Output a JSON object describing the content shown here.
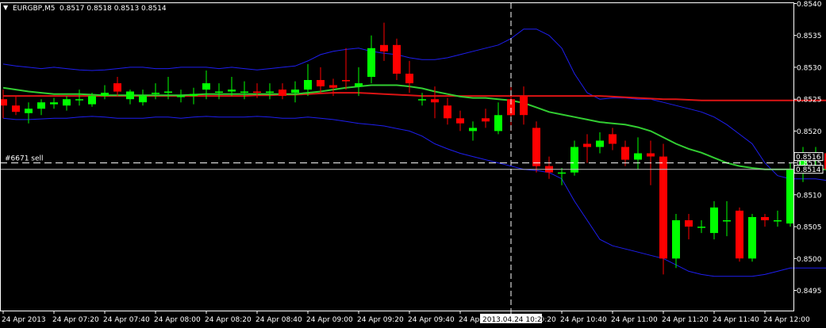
{
  "header": {
    "menu_glyph": "▼",
    "symbol": "EURGBP,M5",
    "ohlc": "0.8517 0.8518 0.8513 0.8514"
  },
  "order_label": "#6671 sell",
  "crosshair_time_label": "2013.04.24 10:20",
  "price_tags": {
    "ask": "0.8516",
    "bid": "0.8514"
  },
  "colors": {
    "background": "#000000",
    "axis": "#ffffff",
    "bull": "#00ff00",
    "bear": "#ff0000",
    "bollinger": "#1e1ef0",
    "ma_fast": "#32cd32",
    "ma_slow": "#dc1414",
    "bid_line": "#c0c0c0"
  },
  "chart_data": {
    "type": "candlestick",
    "symbol": "EURGBP",
    "timeframe": "M5",
    "ylim": [
      0.8492,
      0.854
    ],
    "y_ticks": [
      "0.8540",
      "0.8535",
      "0.8530",
      "0.8525",
      "0.8520",
      "0.8515",
      "0.8510",
      "0.8505",
      "0.8500",
      "0.8495"
    ],
    "x_ticks": [
      "24 Apr 2013",
      "24 Apr 07:20",
      "24 Apr 07:40",
      "24 Apr 08:00",
      "24 Apr 08:20",
      "24 Apr 08:40",
      "24 Apr 09:00",
      "24 Apr 09:20",
      "24 Apr 09:40",
      "24 Apr 10:00",
      "24 Apr 10:20",
      "24 Apr 10:40",
      "24 Apr 11:00",
      "24 Apr 11:20",
      "24 Apr 11:40",
      "24 Apr 12:00"
    ],
    "x_tick_index": [
      0,
      4,
      8,
      12,
      16,
      20,
      24,
      28,
      32,
      36,
      40,
      44,
      48,
      52,
      56,
      60
    ],
    "bid": 0.8514,
    "ask": 0.8516,
    "sell_order": {
      "label": "#6671 sell",
      "price": 0.8515
    },
    "crosshair_index": 40,
    "candles": [
      {
        "o": 0.8525,
        "h": 0.85265,
        "l": 0.8522,
        "c": 0.8524
      },
      {
        "o": 0.8524,
        "h": 0.85255,
        "l": 0.85225,
        "c": 0.8523
      },
      {
        "o": 0.85228,
        "h": 0.85245,
        "l": 0.85212,
        "c": 0.85235
      },
      {
        "o": 0.85235,
        "h": 0.8525,
        "l": 0.85225,
        "c": 0.85245
      },
      {
        "o": 0.85242,
        "h": 0.85252,
        "l": 0.85235,
        "c": 0.85245
      },
      {
        "o": 0.8524,
        "h": 0.85255,
        "l": 0.85232,
        "c": 0.8525
      },
      {
        "o": 0.8525,
        "h": 0.85265,
        "l": 0.8524,
        "c": 0.8525
      },
      {
        "o": 0.85242,
        "h": 0.8526,
        "l": 0.85238,
        "c": 0.85255
      },
      {
        "o": 0.85255,
        "h": 0.85272,
        "l": 0.8525,
        "c": 0.8526
      },
      {
        "o": 0.85275,
        "h": 0.85285,
        "l": 0.85255,
        "c": 0.85262
      },
      {
        "o": 0.8525,
        "h": 0.85265,
        "l": 0.85242,
        "c": 0.85262
      },
      {
        "o": 0.85245,
        "h": 0.85265,
        "l": 0.8524,
        "c": 0.85255
      },
      {
        "o": 0.85258,
        "h": 0.85275,
        "l": 0.8525,
        "c": 0.8526
      },
      {
        "o": 0.8526,
        "h": 0.85285,
        "l": 0.8525,
        "c": 0.85262
      },
      {
        "o": 0.85255,
        "h": 0.85265,
        "l": 0.85245,
        "c": 0.85255
      },
      {
        "o": 0.85255,
        "h": 0.85268,
        "l": 0.85242,
        "c": 0.85258
      },
      {
        "o": 0.85265,
        "h": 0.85295,
        "l": 0.8525,
        "c": 0.85275
      },
      {
        "o": 0.85262,
        "h": 0.85275,
        "l": 0.8525,
        "c": 0.85262
      },
      {
        "o": 0.85262,
        "h": 0.85285,
        "l": 0.85255,
        "c": 0.85265
      },
      {
        "o": 0.85262,
        "h": 0.85278,
        "l": 0.8525,
        "c": 0.85262
      },
      {
        "o": 0.85262,
        "h": 0.85275,
        "l": 0.85252,
        "c": 0.8526
      },
      {
        "o": 0.8526,
        "h": 0.85275,
        "l": 0.8525,
        "c": 0.85262
      },
      {
        "o": 0.85265,
        "h": 0.85275,
        "l": 0.8525,
        "c": 0.85255
      },
      {
        "o": 0.8526,
        "h": 0.85278,
        "l": 0.85245,
        "c": 0.85265
      },
      {
        "o": 0.85265,
        "h": 0.85305,
        "l": 0.85255,
        "c": 0.8528
      },
      {
        "o": 0.8528,
        "h": 0.853,
        "l": 0.8526,
        "c": 0.8527
      },
      {
        "o": 0.85272,
        "h": 0.85282,
        "l": 0.85255,
        "c": 0.85268
      },
      {
        "o": 0.8528,
        "h": 0.8533,
        "l": 0.85265,
        "c": 0.85278
      },
      {
        "o": 0.8527,
        "h": 0.853,
        "l": 0.85255,
        "c": 0.85275
      },
      {
        "o": 0.85285,
        "h": 0.8535,
        "l": 0.85275,
        "c": 0.8533
      },
      {
        "o": 0.85335,
        "h": 0.8537,
        "l": 0.8531,
        "c": 0.85325
      },
      {
        "o": 0.85335,
        "h": 0.85345,
        "l": 0.8528,
        "c": 0.8529
      },
      {
        "o": 0.8529,
        "h": 0.8531,
        "l": 0.8526,
        "c": 0.85275
      },
      {
        "o": 0.8525,
        "h": 0.8526,
        "l": 0.8524,
        "c": 0.8525
      },
      {
        "o": 0.8525,
        "h": 0.8527,
        "l": 0.8522,
        "c": 0.85245
      },
      {
        "o": 0.8524,
        "h": 0.85252,
        "l": 0.8521,
        "c": 0.8522
      },
      {
        "o": 0.8522,
        "h": 0.85232,
        "l": 0.852,
        "c": 0.85212
      },
      {
        "o": 0.852,
        "h": 0.85215,
        "l": 0.85185,
        "c": 0.85205
      },
      {
        "o": 0.8522,
        "h": 0.85235,
        "l": 0.85205,
        "c": 0.85215
      },
      {
        "o": 0.852,
        "h": 0.85245,
        "l": 0.85195,
        "c": 0.85225
      },
      {
        "o": 0.8525,
        "h": 0.8527,
        "l": 0.852,
        "c": 0.85225
      },
      {
        "o": 0.85255,
        "h": 0.8527,
        "l": 0.8521,
        "c": 0.85225
      },
      {
        "o": 0.85205,
        "h": 0.85215,
        "l": 0.85135,
        "c": 0.85145
      },
      {
        "o": 0.85145,
        "h": 0.8516,
        "l": 0.85125,
        "c": 0.85135
      },
      {
        "o": 0.85135,
        "h": 0.85142,
        "l": 0.85115,
        "c": 0.85135
      },
      {
        "o": 0.85135,
        "h": 0.85185,
        "l": 0.8513,
        "c": 0.85175
      },
      {
        "o": 0.8518,
        "h": 0.85195,
        "l": 0.8515,
        "c": 0.85175
      },
      {
        "o": 0.85175,
        "h": 0.85198,
        "l": 0.85165,
        "c": 0.85185
      },
      {
        "o": 0.85195,
        "h": 0.85205,
        "l": 0.8517,
        "c": 0.8518
      },
      {
        "o": 0.85175,
        "h": 0.85185,
        "l": 0.85145,
        "c": 0.85155
      },
      {
        "o": 0.85155,
        "h": 0.8519,
        "l": 0.8514,
        "c": 0.85165
      },
      {
        "o": 0.85165,
        "h": 0.85185,
        "l": 0.85115,
        "c": 0.8516
      },
      {
        "o": 0.8516,
        "h": 0.8518,
        "l": 0.84975,
        "c": 0.85
      },
      {
        "o": 0.85,
        "h": 0.8507,
        "l": 0.84985,
        "c": 0.8506
      },
      {
        "o": 0.8506,
        "h": 0.8507,
        "l": 0.8503,
        "c": 0.8505
      },
      {
        "o": 0.8505,
        "h": 0.8506,
        "l": 0.8504,
        "c": 0.8505
      },
      {
        "o": 0.8504,
        "h": 0.8509,
        "l": 0.8503,
        "c": 0.8508
      },
      {
        "o": 0.8506,
        "h": 0.8509,
        "l": 0.85035,
        "c": 0.8506
      },
      {
        "o": 0.85075,
        "h": 0.8508,
        "l": 0.84995,
        "c": 0.85
      },
      {
        "o": 0.85,
        "h": 0.8507,
        "l": 0.84995,
        "c": 0.85065
      },
      {
        "o": 0.85065,
        "h": 0.8507,
        "l": 0.8505,
        "c": 0.8506
      },
      {
        "o": 0.8506,
        "h": 0.85075,
        "l": 0.8505,
        "c": 0.8506
      },
      {
        "o": 0.85055,
        "h": 0.8515,
        "l": 0.8505,
        "c": 0.8514
      },
      {
        "o": 0.85145,
        "h": 0.85175,
        "l": 0.8512,
        "c": 0.85162
      },
      {
        "o": 0.8516,
        "h": 0.85175,
        "l": 0.85135,
        "c": 0.8516
      },
      {
        "o": 0.85165,
        "h": 0.85175,
        "l": 0.85125,
        "c": 0.8514
      }
    ],
    "bollinger_upper": [
      0.85305,
      0.85302,
      0.853,
      0.85298,
      0.853,
      0.85298,
      0.85296,
      0.85295,
      0.85296,
      0.85298,
      0.853,
      0.853,
      0.85298,
      0.85298,
      0.853,
      0.853,
      0.853,
      0.85298,
      0.853,
      0.85298,
      0.85296,
      0.85298,
      0.853,
      0.85302,
      0.8531,
      0.8532,
      0.85325,
      0.85328,
      0.8533,
      0.85325,
      0.85322,
      0.8532,
      0.85315,
      0.85312,
      0.85312,
      0.85315,
      0.8532,
      0.85325,
      0.8533,
      0.85335,
      0.85345,
      0.8536,
      0.8536,
      0.8535,
      0.8533,
      0.8529,
      0.8526,
      0.8525,
      0.85252,
      0.85252,
      0.8525,
      0.8525,
      0.85245,
      0.8524,
      0.85235,
      0.8523,
      0.85222,
      0.8521,
      0.85195,
      0.8518,
      0.8515,
      0.8513,
      0.85125,
      0.85125,
      0.85125,
      0.85122
    ],
    "bollinger_lower": [
      0.8522,
      0.85218,
      0.85218,
      0.85219,
      0.8522,
      0.8522,
      0.85222,
      0.85223,
      0.85222,
      0.8522,
      0.8522,
      0.8522,
      0.85222,
      0.85222,
      0.8522,
      0.85222,
      0.85223,
      0.85222,
      0.85222,
      0.85222,
      0.85223,
      0.85222,
      0.8522,
      0.8522,
      0.85222,
      0.8522,
      0.85218,
      0.85215,
      0.85212,
      0.8521,
      0.85208,
      0.85204,
      0.852,
      0.85192,
      0.8518,
      0.85172,
      0.85165,
      0.8516,
      0.85155,
      0.8515,
      0.85145,
      0.8514,
      0.85138,
      0.85135,
      0.85125,
      0.8509,
      0.8506,
      0.8503,
      0.8502,
      0.85015,
      0.8501,
      0.85005,
      0.85,
      0.8499,
      0.8498,
      0.84975,
      0.84972,
      0.84972,
      0.84972,
      0.84972,
      0.84975,
      0.8498,
      0.84985,
      0.84985,
      0.84985,
      0.84985
    ],
    "ma_fast": [
      0.85268,
      0.85265,
      0.85262,
      0.8526,
      0.85258,
      0.85258,
      0.85258,
      0.85257,
      0.85256,
      0.85256,
      0.85256,
      0.85256,
      0.85256,
      0.85256,
      0.85256,
      0.85257,
      0.85258,
      0.85258,
      0.85258,
      0.85258,
      0.85258,
      0.85258,
      0.85258,
      0.85258,
      0.8526,
      0.85262,
      0.85265,
      0.85268,
      0.8527,
      0.85272,
      0.85272,
      0.85272,
      0.8527,
      0.85267,
      0.85262,
      0.85258,
      0.85254,
      0.85252,
      0.85252,
      0.8525,
      0.85248,
      0.85244,
      0.85237,
      0.8523,
      0.85226,
      0.85222,
      0.85218,
      0.85214,
      0.85212,
      0.8521,
      0.85206,
      0.852,
      0.8519,
      0.8518,
      0.85172,
      0.85166,
      0.85158,
      0.8515,
      0.85145,
      0.85142,
      0.8514,
      0.8514,
      0.8514,
      0.8514,
      0.8514,
      0.8514
    ],
    "ma_slow": [
      0.85255,
      0.85255,
      0.85255,
      0.85255,
      0.85255,
      0.85255,
      0.85255,
      0.85255,
      0.85255,
      0.85255,
      0.85255,
      0.85255,
      0.85255,
      0.85255,
      0.85255,
      0.85255,
      0.85255,
      0.85255,
      0.85255,
      0.85255,
      0.85256,
      0.85256,
      0.85257,
      0.85257,
      0.85258,
      0.85259,
      0.8526,
      0.8526,
      0.8526,
      0.85259,
      0.85258,
      0.85257,
      0.85256,
      0.85255,
      0.85255,
      0.85255,
      0.85255,
      0.85255,
      0.85255,
      0.85255,
      0.85255,
      0.85255,
      0.85255,
      0.85255,
      0.85255,
      0.85255,
      0.85255,
      0.85255,
      0.85254,
      0.85253,
      0.85252,
      0.85251,
      0.8525,
      0.8525,
      0.85249,
      0.85248,
      0.85248,
      0.85248,
      0.85248,
      0.85248,
      0.85248,
      0.85248,
      0.85248,
      0.85248,
      0.85248,
      0.85248
    ]
  }
}
